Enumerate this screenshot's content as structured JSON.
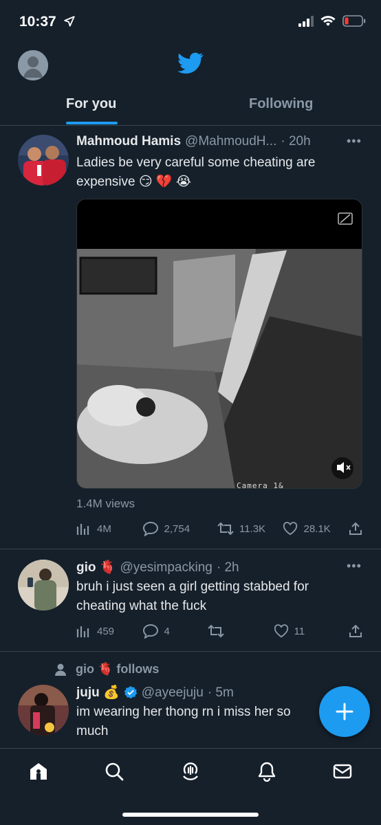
{
  "status_bar": {
    "time": "10:37"
  },
  "tabs": {
    "for_you": "For you",
    "following": "Following"
  },
  "tweets": [
    {
      "name": "Mahmoud Hamis",
      "handle": "@MahmoudH...",
      "time": "· 20h",
      "text_line1": "Ladies be very careful some cheating are",
      "text_line2": "expensive 😏 💔 😭",
      "views": "1.4M views",
      "views_metric": "4M",
      "replies": "2,754",
      "retweets": "11.3K",
      "likes": "28.1K",
      "video_overlay": "Camera 1&"
    },
    {
      "name": "gio",
      "name_emoji": "🫀",
      "handle": "@yesimpacking",
      "time": "· 2h",
      "text_line1": "bruh i just seen a girl getting stabbed for",
      "text_line2": "cheating what the fuck",
      "views_metric": "459",
      "replies": "4",
      "retweets": "",
      "likes": "11"
    },
    {
      "social_context": "gio 🫀 follows",
      "name": "juju",
      "name_emoji": "💰",
      "handle": "@ayeejuju",
      "time": "· 5m",
      "text_line1": "im wearing her thong rn i miss her so",
      "text_line2": "much"
    }
  ],
  "colors": {
    "background": "#15202b",
    "accent": "#1d9bf0",
    "muted": "#8b98a5",
    "divider": "#38444d"
  },
  "icons": {
    "nav": [
      "home-icon",
      "search-icon",
      "spaces-icon",
      "notifications-icon",
      "messages-icon"
    ],
    "fab": "compose-plus-icon"
  }
}
